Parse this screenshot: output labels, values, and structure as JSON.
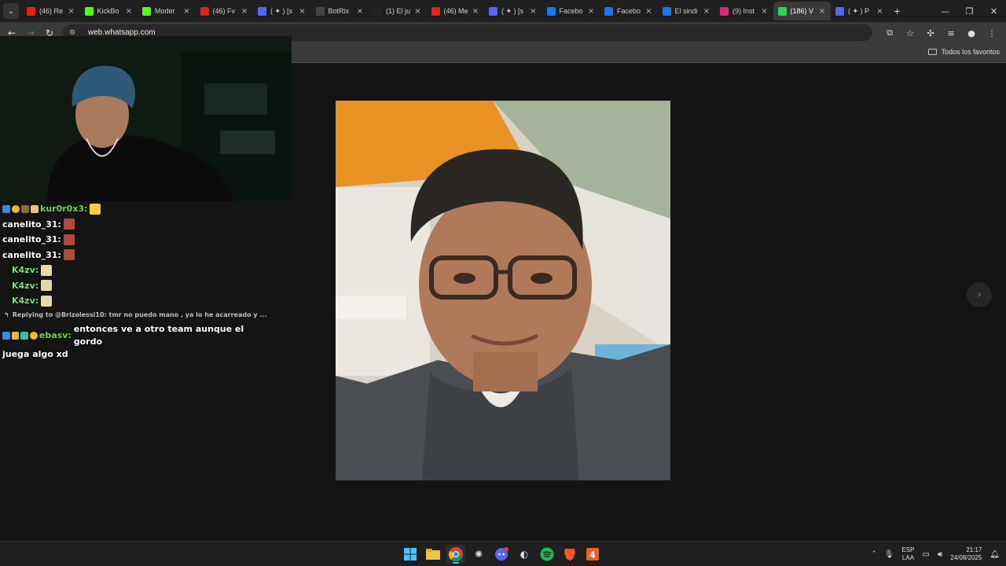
{
  "tabs": [
    {
      "title": "(46) Re",
      "favicon": "youtube-icon",
      "color": "#e62117"
    },
    {
      "title": "KickBo",
      "favicon": "kick-icon",
      "color": "#53fc18"
    },
    {
      "title": "Moder",
      "favicon": "kick-icon",
      "color": "#53fc18"
    },
    {
      "title": "(46) Fv",
      "favicon": "youtube-icon",
      "color": "#e62117"
    },
    {
      "title": "( ✦ ) [s",
      "favicon": "app-icon",
      "color": "#5865f2"
    },
    {
      "title": "BotRix",
      "favicon": "botrix-icon",
      "color": "#444444"
    },
    {
      "title": "(1) El ju",
      "favicon": "tiktok-icon",
      "color": "#222222"
    },
    {
      "title": "(46) Me",
      "favicon": "youtube-icon",
      "color": "#e62117"
    },
    {
      "title": "( ✦ ) [s",
      "favicon": "app-icon",
      "color": "#5865f2"
    },
    {
      "title": "Facebo",
      "favicon": "facebook-icon",
      "color": "#1877f2"
    },
    {
      "title": "Facebo",
      "favicon": "facebook-icon",
      "color": "#1877f2"
    },
    {
      "title": "El sindi",
      "favicon": "facebook-icon",
      "color": "#1877f2"
    },
    {
      "title": "(9) Inst",
      "favicon": "instagram-icon",
      "color": "#d62976"
    },
    {
      "title": "(186) V",
      "favicon": "whatsapp-icon",
      "color": "#25d366",
      "active": true
    },
    {
      "title": "( ✦ ) P",
      "favicon": "app-icon",
      "color": "#5865f2"
    }
  ],
  "address": {
    "url": "web.whatsapp.com"
  },
  "bookmarks": {
    "all_label": "Todos los favoritos"
  },
  "chat": {
    "messages": [
      {
        "user": "kur0r0x3:",
        "color": "#6dd64e",
        "badges": 4
      },
      {
        "user": "canelito_31:",
        "color": "#ffffff",
        "badges": 0
      },
      {
        "user": "canelito_31:",
        "color": "#ffffff",
        "badges": 0
      },
      {
        "user": "canelito_31:",
        "color": "#ffffff",
        "badges": 0
      },
      {
        "user": "K4zv:",
        "color": "#7fe07a",
        "badges": 0,
        "indent": true
      },
      {
        "user": "K4zv:",
        "color": "#7fe07a",
        "badges": 0,
        "indent": true
      },
      {
        "user": "K4zv:",
        "color": "#7fe07a",
        "badges": 0,
        "indent": true
      }
    ],
    "reply_line": "Replying to @Brizolessi10: tmr no puedo mano , ya lo he acarreado y ...",
    "last": {
      "user": "ebasv:",
      "text_line1": "entonces ve a otro team aunque el gordo",
      "text_line2": "juega algo xd"
    }
  },
  "tray": {
    "lang_top": "ESP",
    "lang_bottom": "LAA",
    "time": "21:17",
    "date": "24/08/2025"
  },
  "colors": {
    "accent": "#6cb0ff",
    "whatsapp": "#25d366"
  }
}
